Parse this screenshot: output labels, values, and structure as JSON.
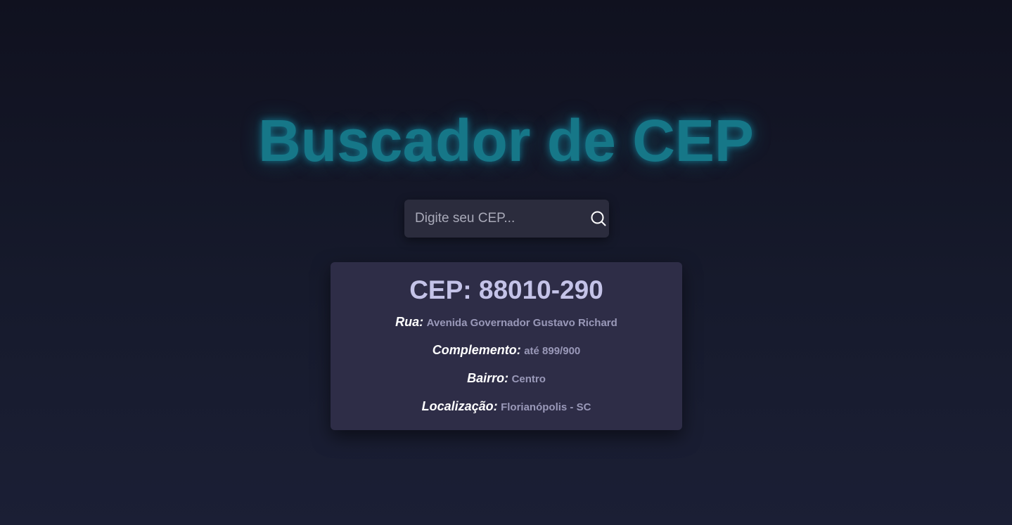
{
  "page": {
    "title": "Buscador de CEP"
  },
  "search": {
    "placeholder": "Digite seu CEP...",
    "value": "",
    "button_icon": "search-icon"
  },
  "result": {
    "cep_heading": "CEP: 88010-290",
    "fields": [
      {
        "label": "Rua:",
        "value": "Avenida Governador Gustavo Richard"
      },
      {
        "label": "Complemento:",
        "value": "até 899/900"
      },
      {
        "label": "Bairro:",
        "value": "Centro"
      },
      {
        "label": "Localização:",
        "value": "Florianópolis - SC"
      }
    ]
  },
  "colors": {
    "title": "#167788",
    "card_background": "#2e2d47",
    "search_background": "#2b2c3d",
    "cep_heading": "#c4c3e8",
    "field_value": "#9a99b9"
  }
}
